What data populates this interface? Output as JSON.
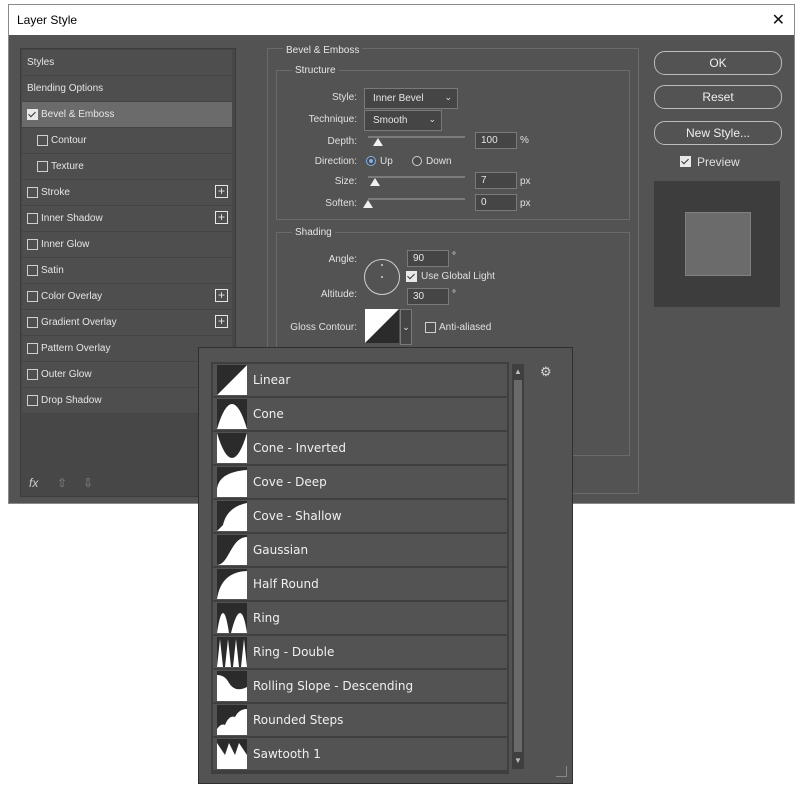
{
  "window": {
    "title": "Layer Style",
    "close": "✕"
  },
  "left_panel": {
    "items": [
      {
        "label": "Styles"
      },
      {
        "label": "Blending Options"
      },
      {
        "label": "Bevel & Emboss"
      },
      {
        "label": "Contour"
      },
      {
        "label": "Texture"
      },
      {
        "label": "Stroke"
      },
      {
        "label": "Inner Shadow"
      },
      {
        "label": "Inner Glow"
      },
      {
        "label": "Satin"
      },
      {
        "label": "Color Overlay"
      },
      {
        "label": "Gradient Overlay"
      },
      {
        "label": "Pattern Overlay"
      },
      {
        "label": "Outer Glow"
      },
      {
        "label": "Drop Shadow"
      }
    ],
    "footer_fx": "fx",
    "footer_up": "⇧",
    "footer_down": "⇩"
  },
  "bevel": {
    "section_title": "Bevel & Emboss",
    "structure": {
      "title": "Structure",
      "style_label": "Style:",
      "style_value": "Inner Bevel",
      "technique_label": "Technique:",
      "technique_value": "Smooth",
      "depth_label": "Depth:",
      "depth_value": "100",
      "depth_unit": "%",
      "direction_label": "Direction:",
      "direction_up": "Up",
      "direction_down": "Down",
      "size_label": "Size:",
      "size_value": "7",
      "size_unit": "px",
      "soften_label": "Soften:",
      "soften_value": "0",
      "soften_unit": "px"
    },
    "shading": {
      "title": "Shading",
      "angle_label": "Angle:",
      "angle_value": "90",
      "degree": "°",
      "global_light": "Use Global Light",
      "altitude_label": "Altitude:",
      "altitude_value": "30",
      "gloss_label": "Gloss Contour:",
      "anti_aliased": "Anti-aliased"
    }
  },
  "buttons": {
    "ok": "OK",
    "reset": "Reset",
    "new_style": "New Style...",
    "preview": "Preview"
  },
  "contour_picker": {
    "gear": "⚙",
    "items": [
      {
        "name": "Linear"
      },
      {
        "name": "Cone"
      },
      {
        "name": "Cone - Inverted"
      },
      {
        "name": "Cove - Deep"
      },
      {
        "name": "Cove - Shallow"
      },
      {
        "name": "Gaussian"
      },
      {
        "name": "Half Round"
      },
      {
        "name": "Ring"
      },
      {
        "name": "Ring - Double"
      },
      {
        "name": "Rolling Slope - Descending"
      },
      {
        "name": "Rounded Steps"
      },
      {
        "name": "Sawtooth 1"
      }
    ]
  }
}
